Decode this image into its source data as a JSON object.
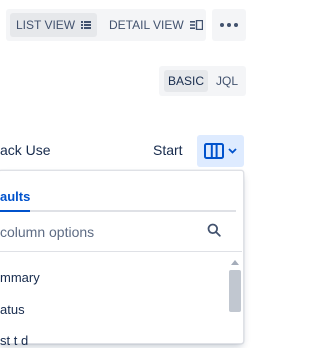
{
  "toolbar": {
    "list_view_label": "LIST VIEW",
    "detail_view_label": "DETAIL VIEW",
    "more_icon": "more-horizontal-icon"
  },
  "search_mode": {
    "basic_label": "BASIC",
    "jql_label": "JQL"
  },
  "table_header": {
    "col_track_use": "ack Use",
    "col_start": "Start ɖ"
  },
  "column_picker": {
    "tab_label": "aults",
    "search_placeholder": "column options",
    "options": [
      "mmary",
      "atus",
      "st t d"
    ]
  },
  "colors": {
    "accent": "#0052CC",
    "selected_bg": "#DEEBFF",
    "toolbar_bg": "#F4F5F7"
  }
}
